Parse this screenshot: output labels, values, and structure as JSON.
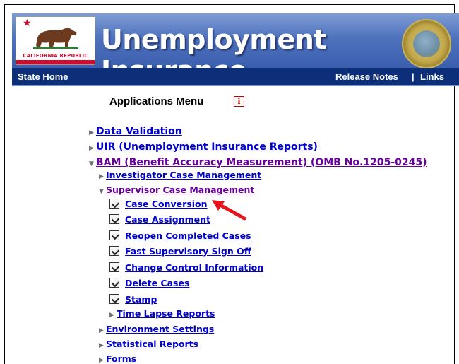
{
  "banner": {
    "flag_text": "CALIFORNIA REPUBLIC",
    "title": "Unemployment Insurance"
  },
  "nav": {
    "state_home": "State Home",
    "release_notes": "Release Notes",
    "separator": "|",
    "links": "Links"
  },
  "menu": {
    "title": "Applications Menu",
    "info_icon": "i",
    "items": [
      {
        "label": "Data Validation"
      },
      {
        "label": "UIR (Unemployment Insurance Reports)"
      },
      {
        "label": "BAM (Benefit Accuracy Measurement) (OMB No.1205-0245)"
      },
      {
        "label": "Investigator Case Management"
      },
      {
        "label": "Supervisor Case Management"
      },
      {
        "label": "Case Conversion"
      },
      {
        "label": "Case Assignment"
      },
      {
        "label": "Reopen Completed Cases"
      },
      {
        "label": "Fast Supervisory Sign Off"
      },
      {
        "label": "Change Control Information"
      },
      {
        "label": "Delete Cases"
      },
      {
        "label": "Stamp"
      },
      {
        "label": "Time Lapse Reports"
      },
      {
        "label": "Environment Settings"
      },
      {
        "label": "Statistical Reports"
      },
      {
        "label": "Forms"
      }
    ]
  },
  "colors": {
    "link": "#0000cc",
    "visited_link": "#660099",
    "navbar": "#0d2f7a",
    "annotation_arrow": "#e8141c"
  }
}
